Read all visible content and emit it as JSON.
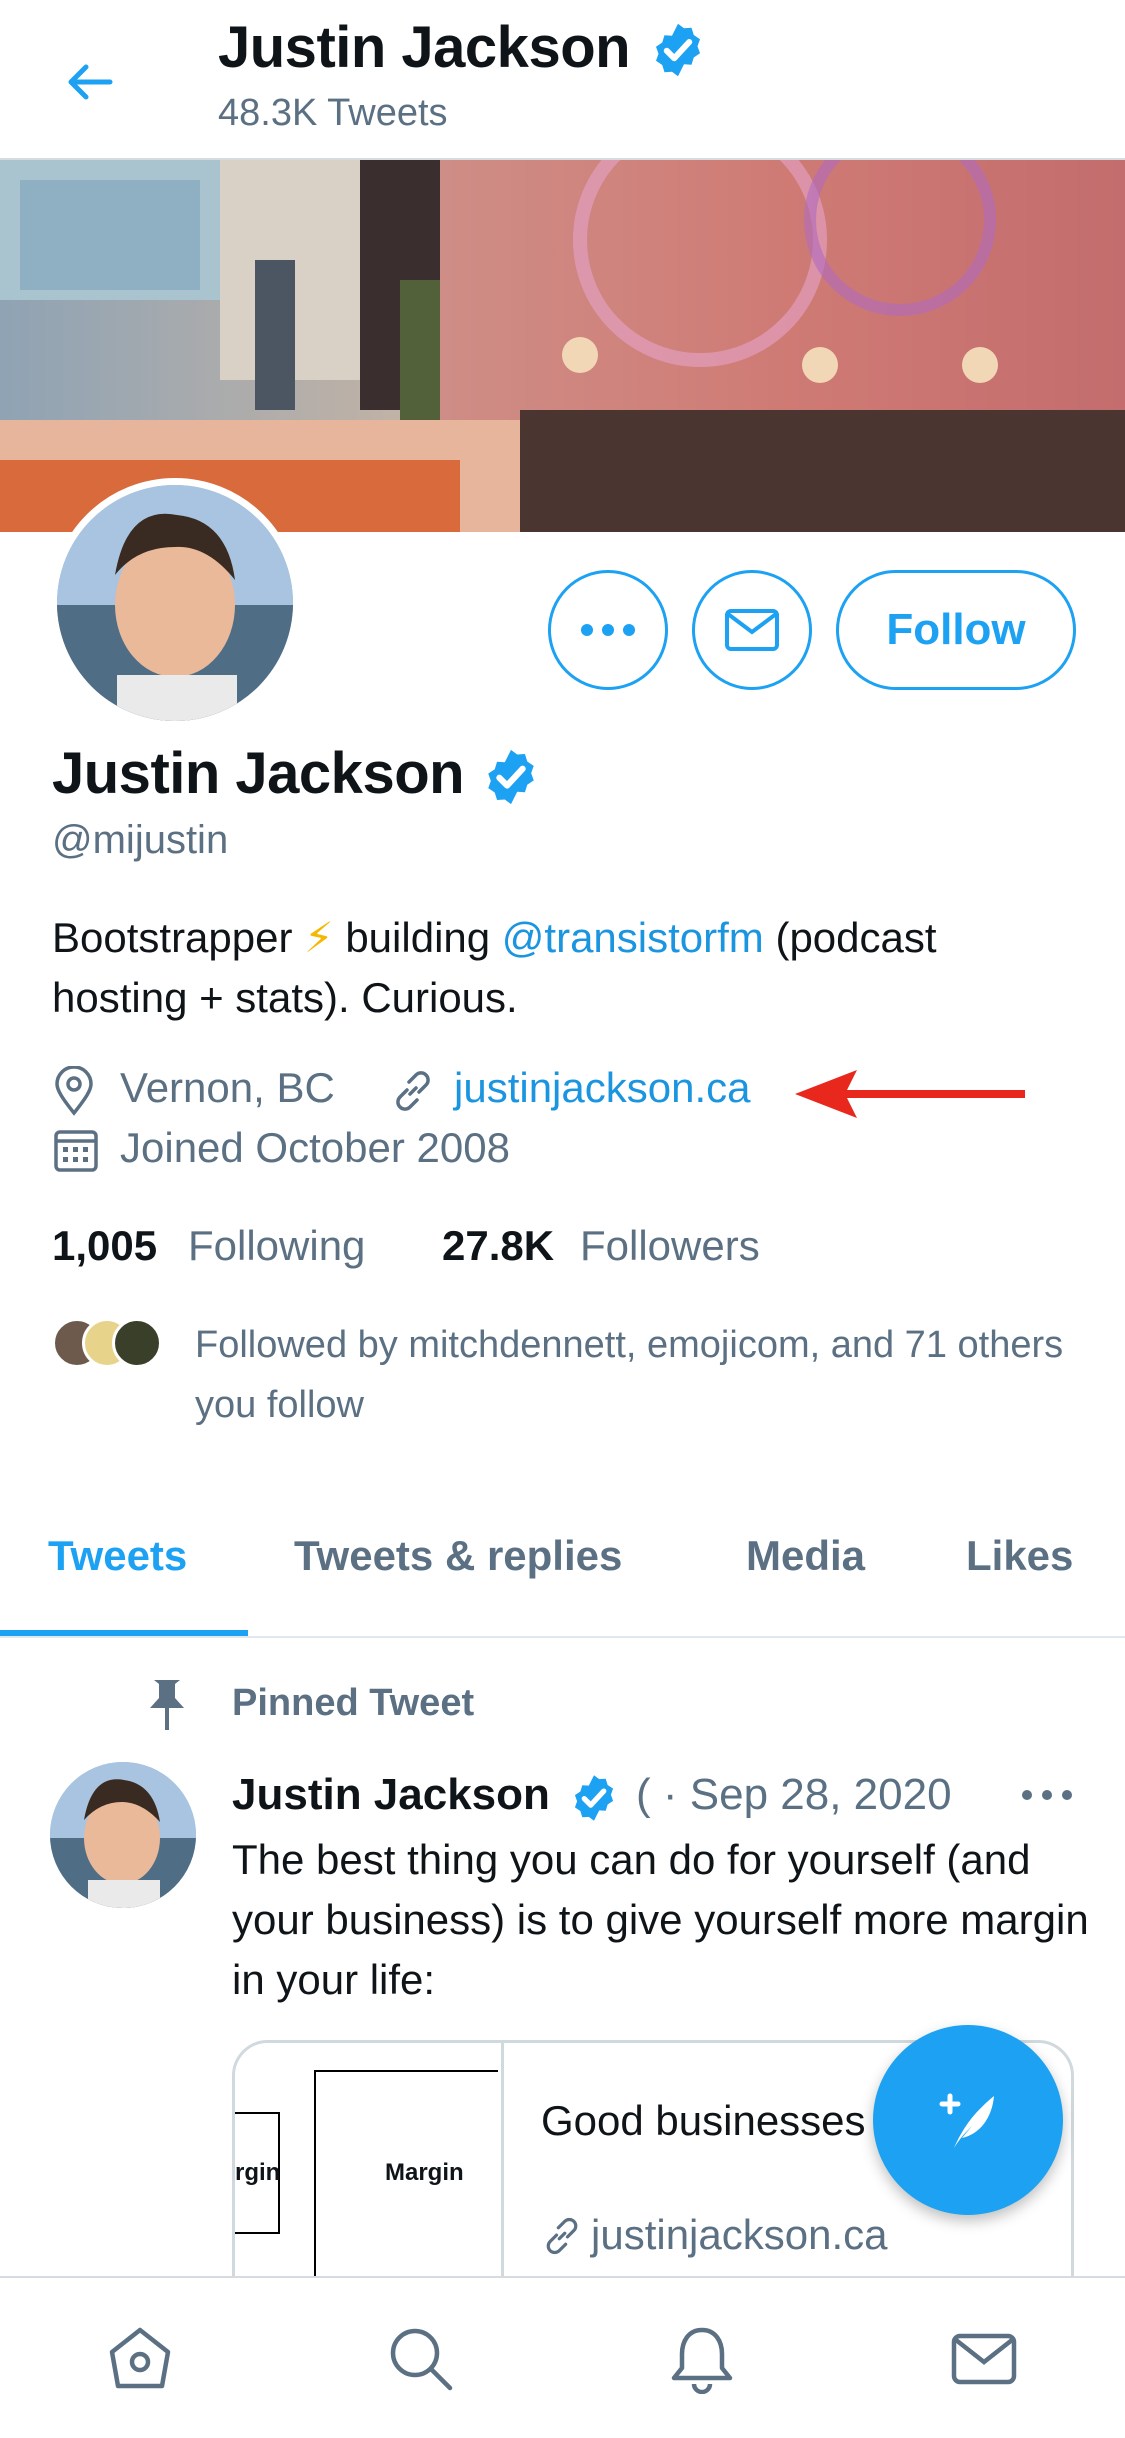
{
  "header": {
    "name": "Justin Jackson",
    "tweet_count": "48.3K Tweets"
  },
  "profile": {
    "name": "Justin Jackson",
    "handle": "@mijustin",
    "bio_before": "Bootstrapper ",
    "bio_emoji": "⚡",
    "bio_middle": " building ",
    "bio_link": "@transistorfm",
    "bio_after": " (podcast hosting + stats). Curious.",
    "location": "Vernon, BC",
    "website": "justinjackson.ca",
    "joined": "Joined October 2008",
    "following_count": "1,005",
    "following_label": "Following",
    "followers_count": "27.8K",
    "followers_label": "Followers",
    "followed_by": "Followed by mitchdennett, emojicom, and 71 others you follow"
  },
  "actions": {
    "follow_label": "Follow"
  },
  "tabs": [
    "Tweets",
    "Tweets & replies",
    "Media",
    "Likes"
  ],
  "pinned_tweet": {
    "pinned_label": "Pinned Tweet",
    "author": "Justin Jackson",
    "date": "( · Sep 28, 2020",
    "text": "The best thing you can do for yourself (and your business) is to give yourself more margin in your life:",
    "card": {
      "image_label_left": "rgin",
      "image_label_center": "Margin",
      "title": "Good businesses margin",
      "link": "justinjackson.ca"
    }
  },
  "colors": {
    "accent": "#1da1f2",
    "link": "#1b95e0",
    "secondary_text": "#5b7083",
    "arrow": "#e8281c"
  },
  "icons": [
    "back-arrow-icon",
    "verified-badge-icon",
    "more-icon",
    "mail-icon",
    "location-icon",
    "link-icon",
    "calendar-icon",
    "pin-icon",
    "compose-icon",
    "home-icon",
    "search-icon",
    "bell-icon"
  ]
}
